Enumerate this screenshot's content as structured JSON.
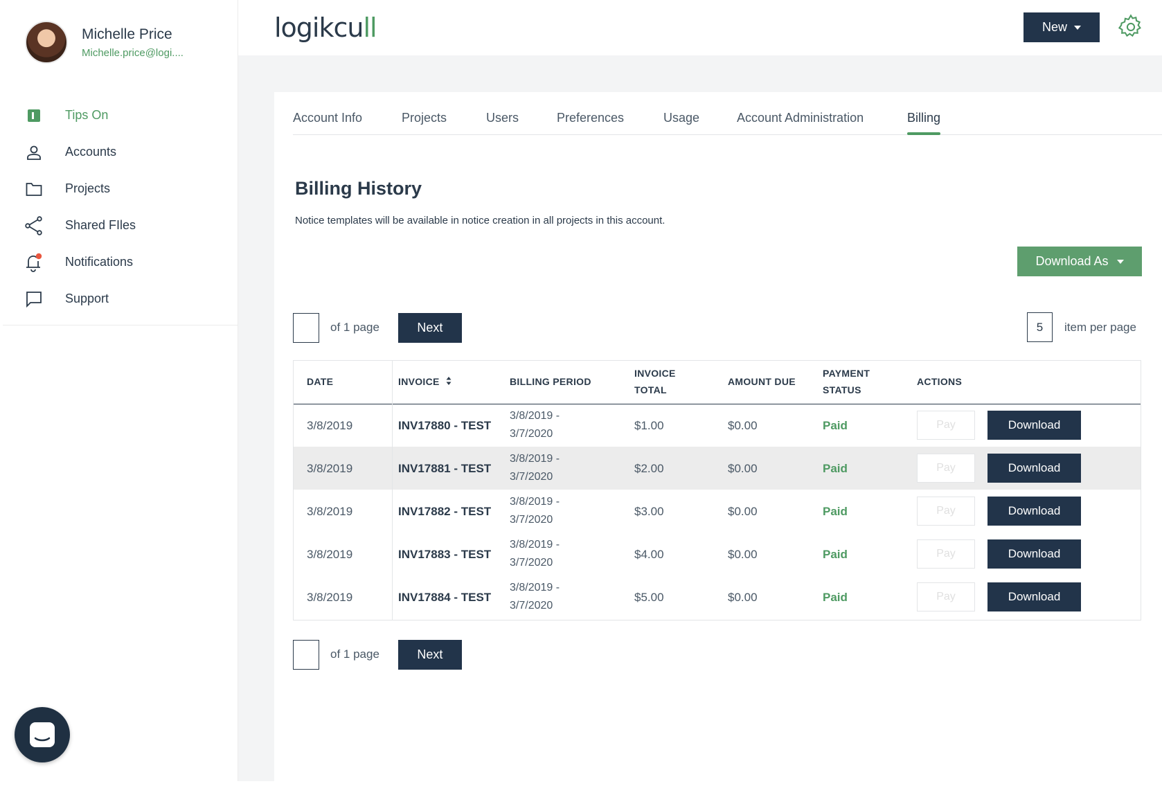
{
  "user": {
    "name": "Michelle Price",
    "email": "Michelle.price@logi...."
  },
  "nav": [
    {
      "label": "Tips On"
    },
    {
      "label": "Accounts"
    },
    {
      "label": "Projects"
    },
    {
      "label": "Shared FIles"
    },
    {
      "label": "Notifications"
    },
    {
      "label": "Support"
    }
  ],
  "brand": {
    "name": "logikcu",
    "accent": "ll"
  },
  "header": {
    "new_label": "New"
  },
  "tabs": [
    "Account Info",
    "Projects",
    "Users",
    "Preferences",
    "Usage",
    "Account Administration",
    "Billing"
  ],
  "billing": {
    "title": "Billing History",
    "subtitle": "Notice templates will be available in notice creation in all projects in this account.",
    "download_as": "Download As",
    "page_text": "of 1 page",
    "next_label": "Next",
    "per_page_value": "5",
    "per_page_text": "item per page",
    "columns": {
      "date": "DATE",
      "invoice": "INVOICE",
      "period": "BILLING PERIOD",
      "total_1": "INVOICE",
      "total_2": "TOTAL",
      "due": "AMOUNT DUE",
      "status_1": "PAYMENT",
      "status_2": "STATUS",
      "actions": "ACTIONS"
    },
    "rows": [
      {
        "date": "3/8/2019",
        "invoice": "INV17880 - TEST",
        "period_start": "3/8/2019 -",
        "period_end": "3/7/2020",
        "total": "$1.00",
        "due": "$0.00",
        "status": "Paid",
        "pay": "Pay",
        "download": "Download"
      },
      {
        "date": "3/8/2019",
        "invoice": "INV17881 - TEST",
        "period_start": "3/8/2019 -",
        "period_end": "3/7/2020",
        "total": "$2.00",
        "due": "$0.00",
        "status": "Paid",
        "pay": "Pay",
        "download": "Download"
      },
      {
        "date": "3/8/2019",
        "invoice": "INV17882 - TEST",
        "period_start": "3/8/2019 -",
        "period_end": "3/7/2020",
        "total": "$3.00",
        "due": "$0.00",
        "status": "Paid",
        "pay": "Pay",
        "download": "Download"
      },
      {
        "date": "3/8/2019",
        "invoice": "INV17883 - TEST",
        "period_start": "3/8/2019 -",
        "period_end": "3/7/2020",
        "total": "$4.00",
        "due": "$0.00",
        "status": "Paid",
        "pay": "Pay",
        "download": "Download"
      },
      {
        "date": "3/8/2019",
        "invoice": "INV17884 - TEST",
        "period_start": "3/8/2019 -",
        "period_end": "3/7/2020",
        "total": "$5.00",
        "due": "$0.00",
        "status": "Paid",
        "pay": "Pay",
        "download": "Download"
      }
    ]
  },
  "colors": {
    "accent": "#4e9a62",
    "navy": "#22344a",
    "notification_dot": "#e9573f"
  }
}
